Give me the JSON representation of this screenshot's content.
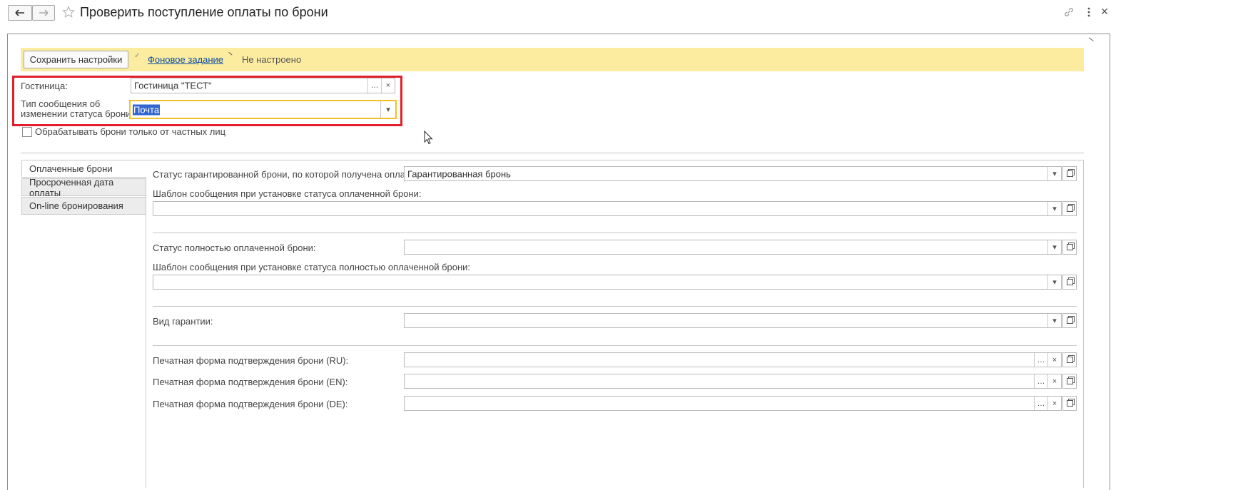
{
  "window": {
    "title": "Проверить поступление оплаты по брони"
  },
  "toolbar": {
    "save_settings_label": "Сохранить настройки",
    "background_job_link": "Фоновое задание",
    "not_configured_text": "Не настроено"
  },
  "header_fields": {
    "hotel": {
      "label": "Гостиница:",
      "value": "Гостиница \"ТЕСТ\""
    },
    "message_type": {
      "label_line1": "Тип сообщения об",
      "label_line2": "изменении статуса брони:",
      "value": "Почта"
    },
    "private_only_checkbox": {
      "label": "Обрабатывать брони только от частных лиц",
      "checked": false
    }
  },
  "tabs": [
    {
      "label": "Оплаченные брони",
      "active": true
    },
    {
      "label": "Просроченная дата оплаты",
      "active": false
    },
    {
      "label": "On-line бронирования",
      "active": false
    }
  ],
  "paid_tab": {
    "guaranteed_status": {
      "label": "Статус гарантированной брони, по которой получена оплата:",
      "value": "Гарантированная бронь"
    },
    "paid_template": {
      "label": "Шаблон сообщения при установке статуса оплаченной брони:",
      "value": ""
    },
    "fully_paid_status": {
      "label": "Статус полностью оплаченной брони:",
      "value": ""
    },
    "fully_paid_template": {
      "label": "Шаблон сообщения при установке статуса полностью оплаченной брони:",
      "value": ""
    },
    "guarantee_type": {
      "label": "Вид гарантии:",
      "value": ""
    },
    "print_ru": {
      "label": "Печатная форма подтверждения брони (RU):",
      "value": ""
    },
    "print_en": {
      "label": "Печатная форма подтверждения брони (EN):",
      "value": ""
    },
    "print_de": {
      "label": "Печатная форма подтверждения брони (DE):",
      "value": ""
    }
  },
  "colors": {
    "toolbar_bg": "#fbeca0",
    "highlight_frame": "#e0202a",
    "focus_border": "#f2c02b",
    "selection": "#3366cc",
    "link": "#0c4da2"
  },
  "icons": {
    "back": "arrow-left-icon",
    "forward": "arrow-right-icon",
    "favorite": "star-icon",
    "link": "link-icon",
    "more": "more-vertical-icon",
    "cursor": "mouse-pointer-icon"
  }
}
